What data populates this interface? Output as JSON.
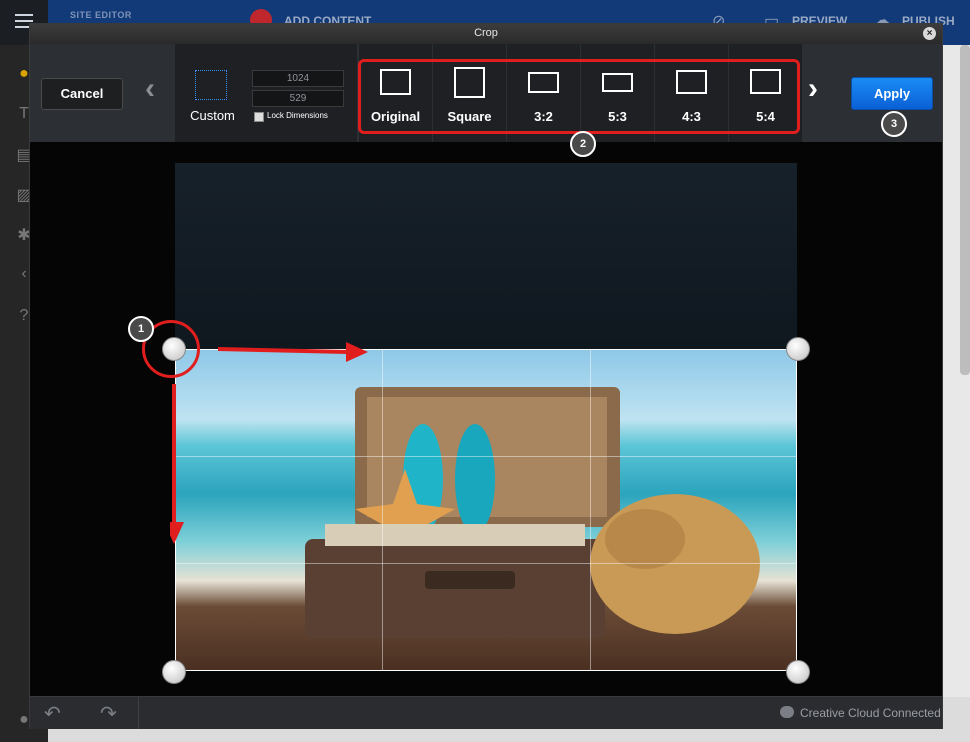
{
  "background": {
    "site_editor": "SITE EDITOR",
    "add_content": "ADD CONTENT",
    "preview": "PREVIEW",
    "publish": "PUBLISH"
  },
  "dialog": {
    "title": "Crop",
    "close_icon": "close-icon",
    "toolbar": {
      "cancel_label": "Cancel",
      "custom_label": "Custom",
      "width_value": "1024",
      "height_value": "529",
      "lock_label": "Lock Dimensions",
      "presets": [
        {
          "label": "Original"
        },
        {
          "label": "Square"
        },
        {
          "label": "3:2"
        },
        {
          "label": "5:3"
        },
        {
          "label": "4:3"
        },
        {
          "label": "5:4"
        }
      ],
      "apply_label": "Apply"
    },
    "callouts": [
      "1",
      "2",
      "3"
    ],
    "footer": {
      "status": "Creative Cloud Connected"
    }
  },
  "colors": {
    "accent_blue": "#1b8cf5",
    "annotation_red": "#e01e1e"
  }
}
